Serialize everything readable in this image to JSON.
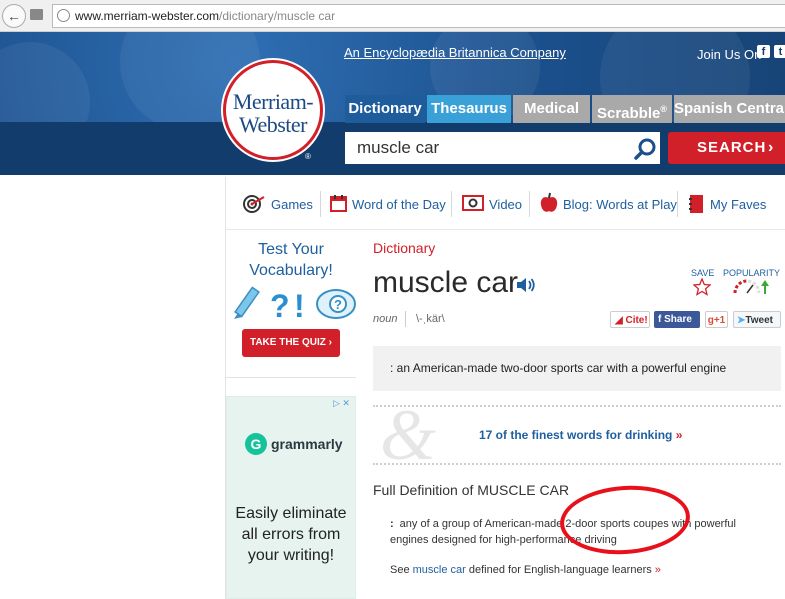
{
  "browser": {
    "url_host": "www.merriam-webster.com",
    "url_path": "/dictionary/muscle car"
  },
  "header": {
    "britannica_link": "An Encyclopædia Britannica Company",
    "join_us": "Join Us On",
    "logo_line1": "Merriam-",
    "logo_line2": "Webster",
    "tabs": [
      {
        "label": "Dictionary"
      },
      {
        "label": "Thesaurus"
      },
      {
        "label": "Medical"
      },
      {
        "label": "Scrabble",
        "mark": "®"
      },
      {
        "label": "Spanish Central"
      }
    ],
    "search_value": "muscle car",
    "search_button": "SEARCH",
    "colors": {
      "brand_blue": "#1b4f8b",
      "search_red": "#d2202a",
      "thesaurus_tab": "#3aa1d8"
    }
  },
  "subnav": [
    {
      "label": "Games",
      "icon": "target-icon"
    },
    {
      "label": "Word of the Day",
      "icon": "calendar-icon"
    },
    {
      "label": "Video",
      "icon": "video-icon"
    },
    {
      "label": "Blog: Words at Play",
      "icon": "apple-icon"
    },
    {
      "label": "My Faves",
      "icon": "notebook-icon"
    }
  ],
  "sidebar": {
    "quiz_title": "Test Your Vocabulary!",
    "quiz_button": "TAKE THE QUIZ",
    "ad_brand": "grammarly",
    "ad_copy": "Easily eliminate all errors from your writing!"
  },
  "entry": {
    "section": "Dictionary",
    "headword": "muscle car",
    "save_label": "SAVE",
    "popularity_label": "POPULARITY",
    "part_of_speech": "noun",
    "pronunciation": "\\-ˌkär\\",
    "share_buttons": {
      "cite": "Cite!",
      "share": "Share",
      "gplus": "g+1",
      "tweet": "Tweet"
    },
    "short_definition": ": an American-made two-door sports car with a powerful engine",
    "promo_link": "17 of the finest words for drinking",
    "full_def_heading": "Full Definition of MUSCLE CAR",
    "full_def_colon": ":",
    "full_definition": "any of a group of American-made 2-door sports coupes with powerful engines designed for high-performance driving",
    "learners_prefix": "See",
    "learners_link": "muscle car",
    "learners_suffix": "defined for English-language learners",
    "arrow": "»"
  }
}
